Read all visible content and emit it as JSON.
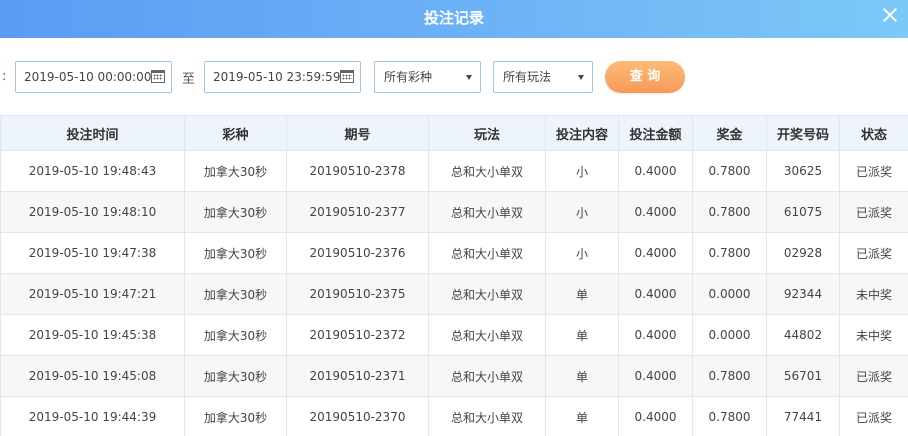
{
  "window": {
    "title": "投注记录"
  },
  "filter": {
    "colon": ":",
    "start_date": "2019-05-10 00:00:00",
    "to_label": "至",
    "end_date": "2019-05-10 23:59:59",
    "lottery_select": "所有彩种",
    "play_select": "所有玩法",
    "query_label": "查 询"
  },
  "colors": {
    "title_gradient_start": "#5a9cf3",
    "title_gradient_end": "#7cc8f7",
    "button": "#f79a56",
    "status_paid": "#f27a29",
    "status_lost": "#999999"
  },
  "table": {
    "headers": [
      "投注时间",
      "彩种",
      "期号",
      "玩法",
      "投注内容",
      "投注金额",
      "奖金",
      "开奖号码",
      "状态"
    ],
    "rows": [
      [
        "2019-05-10 19:48:43",
        "加拿大30秒",
        "20190510-2378",
        "总和大小单双",
        "小",
        "0.4000",
        "0.7800",
        "30625",
        "已派奖"
      ],
      [
        "2019-05-10 19:48:10",
        "加拿大30秒",
        "20190510-2377",
        "总和大小单双",
        "小",
        "0.4000",
        "0.7800",
        "61075",
        "已派奖"
      ],
      [
        "2019-05-10 19:47:38",
        "加拿大30秒",
        "20190510-2376",
        "总和大小单双",
        "小",
        "0.4000",
        "0.7800",
        "02928",
        "已派奖"
      ],
      [
        "2019-05-10 19:47:21",
        "加拿大30秒",
        "20190510-2375",
        "总和大小单双",
        "单",
        "0.4000",
        "0.0000",
        "92344",
        "未中奖"
      ],
      [
        "2019-05-10 19:45:38",
        "加拿大30秒",
        "20190510-2372",
        "总和大小单双",
        "单",
        "0.4000",
        "0.0000",
        "44802",
        "未中奖"
      ],
      [
        "2019-05-10 19:45:08",
        "加拿大30秒",
        "20190510-2371",
        "总和大小单双",
        "单",
        "0.4000",
        "0.7800",
        "56701",
        "已派奖"
      ],
      [
        "2019-05-10 19:44:39",
        "加拿大30秒",
        "20190510-2370",
        "总和大小单双",
        "单",
        "0.4000",
        "0.7800",
        "77441",
        "已派奖"
      ]
    ]
  }
}
